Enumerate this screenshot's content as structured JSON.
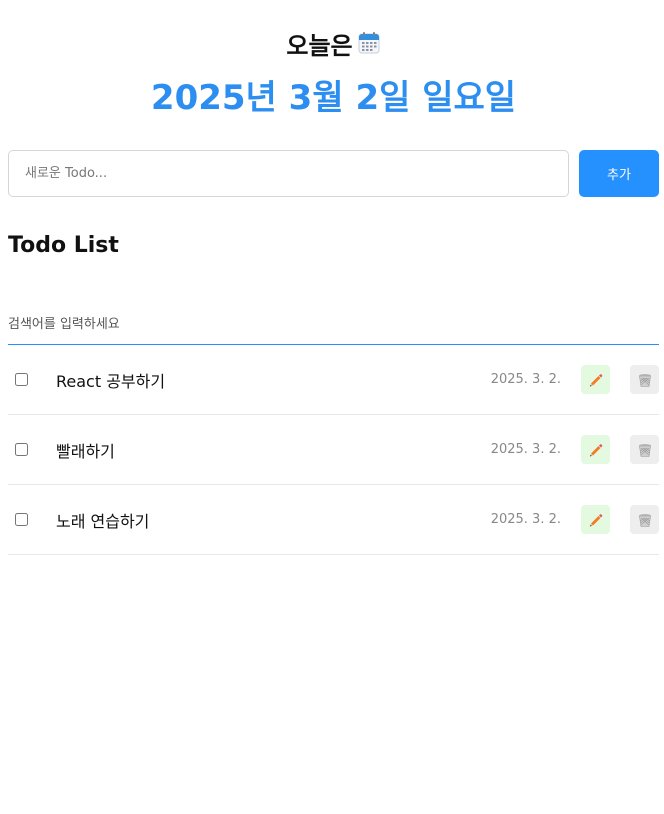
{
  "header": {
    "today_label": "오늘은",
    "calendar_icon": "calendar-icon",
    "date": "2025년 3월 2일 일요일",
    "accent_color": "#2c8ef0"
  },
  "editor": {
    "placeholder": "새로운 Todo...",
    "add_label": "추가",
    "button_color": "#2591ff"
  },
  "list": {
    "title": "Todo List",
    "search_placeholder": "검색어를 입력하세요",
    "items": [
      {
        "checked": false,
        "content": "React 공부하기",
        "date": "2025. 3. 2.",
        "edit_icon": "pencil-icon",
        "delete_icon": "trash-icon"
      },
      {
        "checked": false,
        "content": "빨래하기",
        "date": "2025. 3. 2.",
        "edit_icon": "pencil-icon",
        "delete_icon": "trash-icon"
      },
      {
        "checked": false,
        "content": "노래 연습하기",
        "date": "2025. 3. 2.",
        "edit_icon": "pencil-icon",
        "delete_icon": "trash-icon"
      }
    ]
  }
}
